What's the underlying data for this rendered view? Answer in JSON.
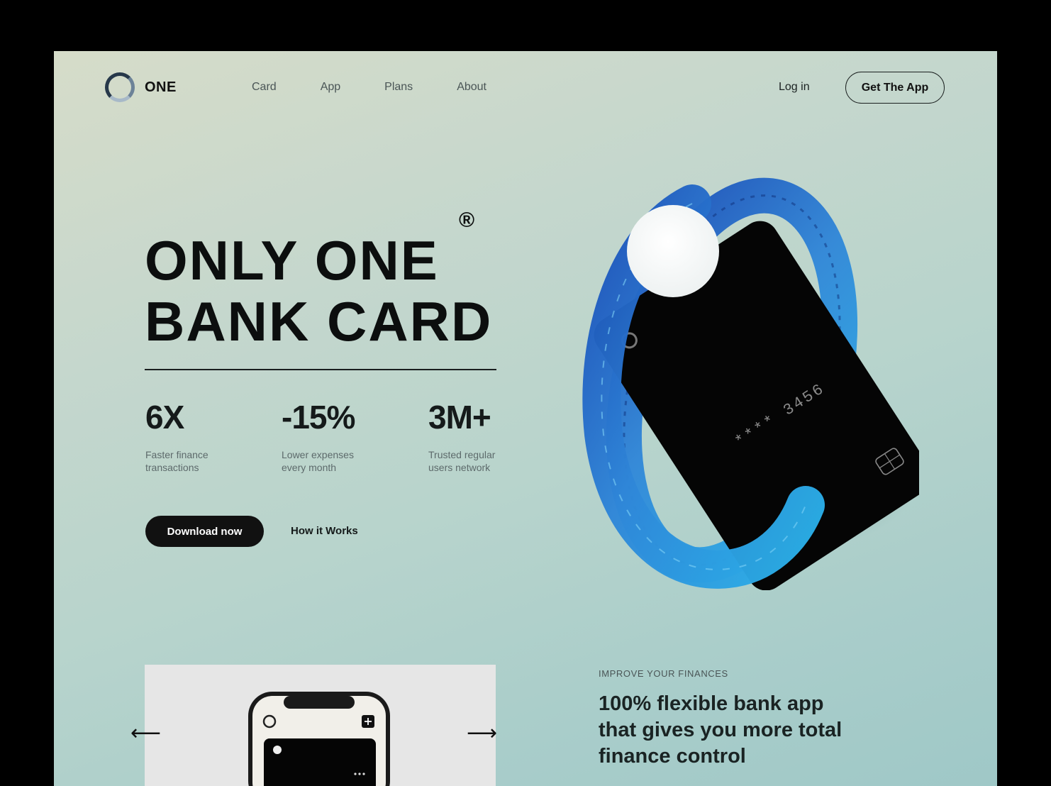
{
  "brand": {
    "name": "ONE"
  },
  "nav": {
    "items": [
      "Card",
      "App",
      "Plans",
      "About"
    ]
  },
  "header": {
    "login": "Log in",
    "cta": "Get The App"
  },
  "hero": {
    "title_line1": "ONLY ONE",
    "title_line2": "BANK CARD",
    "registered": "®",
    "stats": [
      {
        "value": "6X",
        "label_line1": "Faster finance",
        "label_line2": "transactions"
      },
      {
        "value": "-15%",
        "label_line1": "Lower expenses",
        "label_line2": "every month"
      },
      {
        "value": "3M+",
        "label_line1": "Trusted regular",
        "label_line2": "users network"
      }
    ],
    "primary_button": "Download now",
    "secondary_link": "How it Works"
  },
  "card": {
    "number": "**** 3456"
  },
  "bottom": {
    "eyebrow": "IMPROVE YOUR FINANCES",
    "heading_line1": "100% flexible bank app",
    "heading_line2": "that gives you more total",
    "heading_line3": "finance control",
    "prev_arrow": "⟵",
    "next_arrow": "⟶"
  },
  "colors": {
    "accent_blue": "#1f6fd1",
    "dark": "#111111",
    "background": "#b8d4cc"
  }
}
